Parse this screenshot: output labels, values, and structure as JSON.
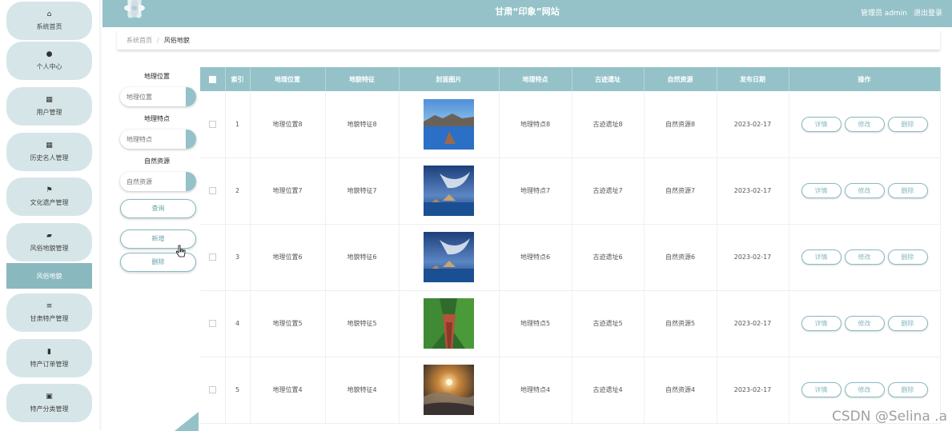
{
  "sidebar": {
    "items": [
      {
        "label": "系统首页",
        "icon": "home-icon",
        "glyph": "⌂"
      },
      {
        "label": "个人中心",
        "icon": "user-icon",
        "glyph": "●"
      },
      {
        "label": "用户管理",
        "icon": "grid-icon",
        "glyph": "▦"
      },
      {
        "label": "历史名人管理",
        "icon": "grid-icon",
        "glyph": "▦"
      },
      {
        "label": "文化遗产管理",
        "icon": "flag-icon",
        "glyph": "⚑"
      },
      {
        "label": "风俗地貌管理",
        "icon": "briefcase-icon",
        "glyph": "▰"
      },
      {
        "label": "甘肃特产管理",
        "icon": "sliders-icon",
        "glyph": "≡"
      },
      {
        "label": "特产订单管理",
        "icon": "book-icon",
        "glyph": "▮"
      },
      {
        "label": "特产分类管理",
        "icon": "chart-icon",
        "glyph": "▣"
      }
    ],
    "active_sub": "风俗地貌"
  },
  "header": {
    "title": "甘肃“印象”网站",
    "admin": "管理员 admin",
    "logout": "退出登录"
  },
  "breadcrumb": {
    "home": "系统首页",
    "sep": "/",
    "current": "风俗地貌"
  },
  "search": {
    "location_label": "地理位置",
    "location_placeholder": "地理位置",
    "feature_label": "地理特点",
    "feature_placeholder": "地理特点",
    "resource_label": "自然资源",
    "resource_placeholder": "自然资源",
    "query_btn": "查询",
    "add_btn": "新增",
    "delete_btn": "删除"
  },
  "table": {
    "headers": [
      "",
      "索引",
      "地理位置",
      "地貌特征",
      "封面图片",
      "地理特点",
      "古迹遗址",
      "自然资源",
      "发布日期",
      "操作"
    ],
    "ops": {
      "detail": "详情",
      "edit": "修改",
      "delete": "删除"
    },
    "rows": [
      {
        "index": "1",
        "location": "地理位置8",
        "landform": "地貌特征8",
        "feature": "地理特点8",
        "site": "古迹遗址8",
        "resource": "自然资源8",
        "date": "2023-02-17",
        "image": "lake-rock"
      },
      {
        "index": "2",
        "location": "地理位置7",
        "landform": "地貌特征7",
        "feature": "地理特点7",
        "site": "古迹遗址7",
        "resource": "自然资源7",
        "date": "2023-02-17",
        "image": "sea-sky"
      },
      {
        "index": "3",
        "location": "地理位置6",
        "landform": "地貌特征6",
        "feature": "地理特点6",
        "site": "古迹遗址6",
        "resource": "自然资源6",
        "date": "2023-02-17",
        "image": "sea-sky"
      },
      {
        "index": "4",
        "location": "地理位置5",
        "landform": "地貌特征5",
        "feature": "地理特点5",
        "site": "古迹遗址5",
        "resource": "自然资源5",
        "date": "2023-02-17",
        "image": "canyon"
      },
      {
        "index": "5",
        "location": "地理位置4",
        "landform": "地貌特征4",
        "feature": "地理特点4",
        "site": "古迹遗址4",
        "resource": "自然资源4",
        "date": "2023-02-17",
        "image": "sunrise"
      }
    ]
  },
  "watermark": "CSDN @Selina .a",
  "colors": {
    "accent": "#94c2c8",
    "accent_dark": "#8ab8bf",
    "side_bg": "#d6e6e8"
  }
}
